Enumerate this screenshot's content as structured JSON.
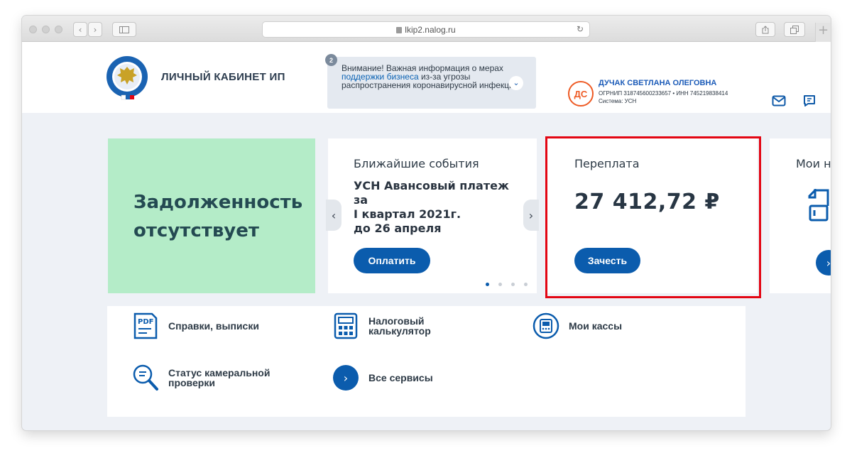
{
  "browser": {
    "url": "lkip2.nalog.ru",
    "new_tab": "+"
  },
  "header": {
    "title": "ЛИЧНЫЙ КАБИНЕТ ИП",
    "notice": {
      "badge": "2",
      "text_before": "Внимание! Важная информация о мерах ",
      "link": "поддержки бизнеса",
      "text_after": " из-за угрозы распространения коронавирусной инфекции:"
    },
    "user": {
      "initials": "ДС",
      "name": "ДУЧАК СВЕТЛАНА ОЛЕГОВНА",
      "ids": "ОГРНИП 318745600233657 • ИНН 745219838414",
      "system": "Система: УСН"
    }
  },
  "cards": {
    "debt": {
      "line1": "Задолженность",
      "line2": "отсутствует"
    },
    "events": {
      "title": "Ближайшие события",
      "line1": "УСН Авансовый платеж за",
      "line2": "I квартал 2021г.",
      "line3": "до 26 апреля",
      "button": "Оплатить",
      "active_slide": 1,
      "slide_count": 4
    },
    "overpay": {
      "title": "Переплата",
      "amount": "27 412,72 ₽",
      "button": "Зачесть"
    },
    "docs": {
      "title": "Мои на"
    }
  },
  "services": {
    "certificates": {
      "icon": "pdf-icon",
      "label": "Справки, выписки"
    },
    "calculator": {
      "icon": "calculator-icon",
      "line1": "Налоговый",
      "line2": "калькулятор"
    },
    "registers": {
      "icon": "cash-register-icon",
      "label": "Мои кассы"
    },
    "audit": {
      "icon": "search-document-icon",
      "line1": "Статус камеральной",
      "line2": "проверки"
    },
    "all": {
      "icon": "chevron-right-icon",
      "label": "Все сервисы"
    }
  },
  "colors": {
    "accent": "#0b5cad",
    "debt_bg": "#b4ecc8",
    "highlight": "#e30613",
    "avatar": "#ee5a24"
  }
}
